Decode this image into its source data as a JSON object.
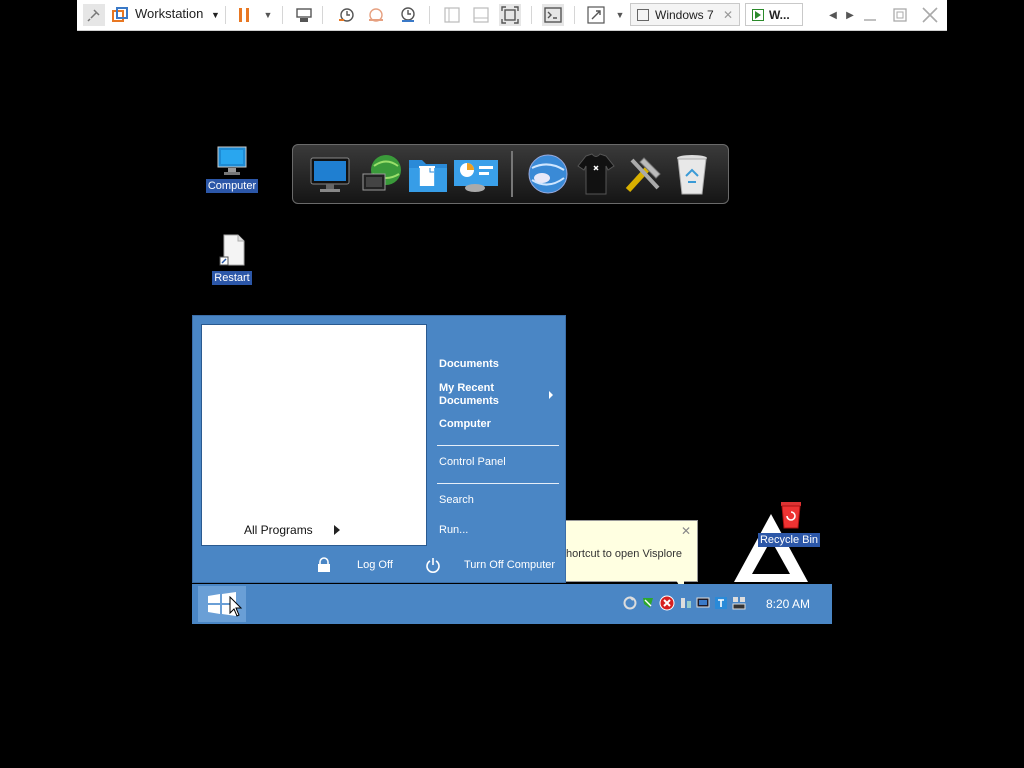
{
  "vmware": {
    "app_name": "Workstation",
    "tabs": [
      {
        "label": "Windows 7",
        "icon": "vm-icon"
      },
      {
        "label": "W...",
        "icon": "vm-running-icon"
      }
    ],
    "icons": [
      "pin-icon",
      "pause-icon",
      "send-ctrl-alt-del-icon",
      "snapshot-icon",
      "revert-snapshot-icon",
      "snapshot-manager-icon",
      "library-icon",
      "thumbnail-icon",
      "fit-guest-icon",
      "console-icon",
      "fullscreen-icon",
      "minimize-icon",
      "restore-icon",
      "close-icon"
    ]
  },
  "desktop": {
    "icons": [
      {
        "label": "Computer",
        "icon": "computer-icon"
      },
      {
        "label": "Restart",
        "icon": "shortcut-file-icon"
      },
      {
        "label": "Recycle Bin",
        "icon": "recycle-bin-icon"
      }
    ],
    "dock_items": [
      "monitor-icon",
      "network-globe-icon",
      "documents-folder-icon",
      "control-panel-icon",
      "internet-globe-icon",
      "shirt-icon",
      "tools-icon",
      "trash-icon"
    ]
  },
  "start_menu": {
    "all_programs": "All Programs",
    "links": {
      "documents": "Documents",
      "recent": "My Recent Documents",
      "computer": "Computer",
      "control_panel": "Control Panel",
      "search": "Search",
      "run": "Run..."
    },
    "log_off": "Log Off",
    "turn_off": "Turn Off Computer"
  },
  "balloon": {
    "text": "hortcut to open Visplore"
  },
  "taskbar": {
    "clock": "8:20 AM",
    "tray_icons": [
      "update-icon",
      "shield-icon",
      "error-icon",
      "network-icon",
      "monitor-icon",
      "app-icon",
      "app-icon"
    ]
  },
  "colors": {
    "taskbar": "#4a86c5",
    "selection": "#2c57a8",
    "accent": "#e87722"
  }
}
